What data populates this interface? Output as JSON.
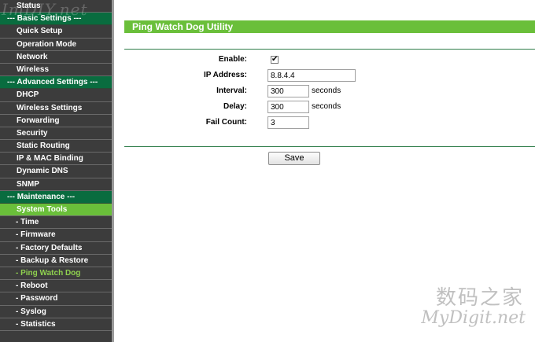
{
  "watermark": {
    "top_logo": "ImDIY.net",
    "cn": "数码之家",
    "en": "MyDigit.net"
  },
  "sidebar": {
    "items": [
      {
        "label": "Status",
        "kind": "item"
      },
      {
        "label": "--- Basic Settings ---",
        "kind": "section"
      },
      {
        "label": "Quick Setup",
        "kind": "item"
      },
      {
        "label": "Operation Mode",
        "kind": "item"
      },
      {
        "label": "Network",
        "kind": "item"
      },
      {
        "label": "Wireless",
        "kind": "item"
      },
      {
        "label": "--- Advanced Settings ---",
        "kind": "section"
      },
      {
        "label": "DHCP",
        "kind": "item"
      },
      {
        "label": "Wireless Settings",
        "kind": "item"
      },
      {
        "label": "Forwarding",
        "kind": "item"
      },
      {
        "label": "Security",
        "kind": "item"
      },
      {
        "label": "Static Routing",
        "kind": "item"
      },
      {
        "label": "IP & MAC Binding",
        "kind": "item"
      },
      {
        "label": "Dynamic DNS",
        "kind": "item"
      },
      {
        "label": "SNMP",
        "kind": "item"
      },
      {
        "label": "--- Maintenance ---",
        "kind": "section"
      },
      {
        "label": "System Tools",
        "kind": "selected-parent"
      },
      {
        "label": "- Time",
        "kind": "sub"
      },
      {
        "label": "- Firmware",
        "kind": "sub"
      },
      {
        "label": "- Factory Defaults",
        "kind": "sub"
      },
      {
        "label": "- Backup & Restore",
        "kind": "sub"
      },
      {
        "label": "- Ping Watch Dog",
        "kind": "active-sub"
      },
      {
        "label": "- Reboot",
        "kind": "sub"
      },
      {
        "label": "- Password",
        "kind": "sub"
      },
      {
        "label": "- Syslog",
        "kind": "sub"
      },
      {
        "label": "- Statistics",
        "kind": "sub"
      }
    ]
  },
  "main": {
    "title": "Ping Watch Dog Utility",
    "enable_label": "Enable:",
    "enable_checked": true,
    "ip_label": "IP Address:",
    "ip_value": "8.8.4.4",
    "interval_label": "Interval:",
    "interval_value": "300",
    "interval_unit": "seconds",
    "delay_label": "Delay:",
    "delay_value": "300",
    "delay_unit": "seconds",
    "failcount_label": "Fail Count:",
    "failcount_value": "3",
    "save_label": "Save",
    "check_glyph": "✔"
  },
  "colors": {
    "accent_green": "#6abf3a",
    "section_green": "#096c3f",
    "sidebar_bg": "#3c3c3c"
  }
}
